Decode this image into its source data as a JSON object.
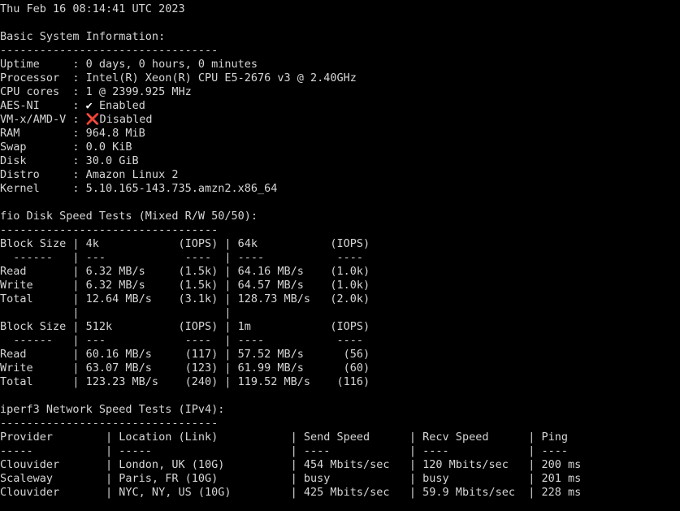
{
  "lines": [
    "Thu Feb 16 08:14:41 UTC 2023",
    "",
    "Basic System Information:",
    "---------------------------------",
    "Uptime     : 0 days, 0 hours, 0 minutes",
    "Processor  : Intel(R) Xeon(R) CPU E5-2676 v3 @ 2.40GHz",
    "CPU cores  : 1 @ 2399.925 MHz",
    "AES-NI     : ",
    "VM-x/AMD-V : ",
    "RAM        : 964.8 MiB",
    "Swap       : 0.0 KiB",
    "Disk       : 30.0 GiB",
    "Distro     : Amazon Linux 2",
    "Kernel     : 5.10.165-143.735.amzn2.x86_64",
    "",
    "fio Disk Speed Tests (Mixed R/W 50/50):",
    "---------------------------------",
    "Block Size | 4k            (IOPS) | 64k           (IOPS)",
    "  ------   | ---            ----  | ----           ----",
    "Read       | 6.32 MB/s     (1.5k) | 64.16 MB/s    (1.0k)",
    "Write      | 6.32 MB/s     (1.5k) | 64.57 MB/s    (1.0k)",
    "Total      | 12.64 MB/s    (3.1k) | 128.73 MB/s   (2.0k)",
    "           |                      |",
    "Block Size | 512k          (IOPS) | 1m            (IOPS)",
    "  ------   | ---            ----  | ----           ----",
    "Read       | 60.16 MB/s     (117) | 57.52 MB/s      (56)",
    "Write      | 63.07 MB/s     (123) | 61.99 MB/s      (60)",
    "Total      | 123.23 MB/s    (240) | 119.52 MB/s    (116)",
    "",
    "iperf3 Network Speed Tests (IPv4):",
    "---------------------------------",
    "Provider        | Location (Link)           | Send Speed      | Recv Speed      | Ping",
    "-----           | -----                     | ----            | ----            | ----",
    "Clouvider       | London, UK (10G)          | 454 Mbits/sec   | 120 Mbits/sec   | 200 ms",
    "Scaleway        | Paris, FR (10G)           | busy            | busy            | 201 ms",
    "Clouvider       | NYC, NY, US (10G)         | 425 Mbits/sec   | 59.9 Mbits/sec  | 228 ms"
  ],
  "aesni": {
    "icon": "check-mark-icon",
    "glyph": "✔",
    "status": " Enabled"
  },
  "vmx": {
    "icon": "cross-mark-icon",
    "glyph": "❌",
    "status": "Disabled"
  },
  "colors": {
    "background": "#000000",
    "foreground": "#d6d6d6",
    "cross": "#e0312f"
  }
}
